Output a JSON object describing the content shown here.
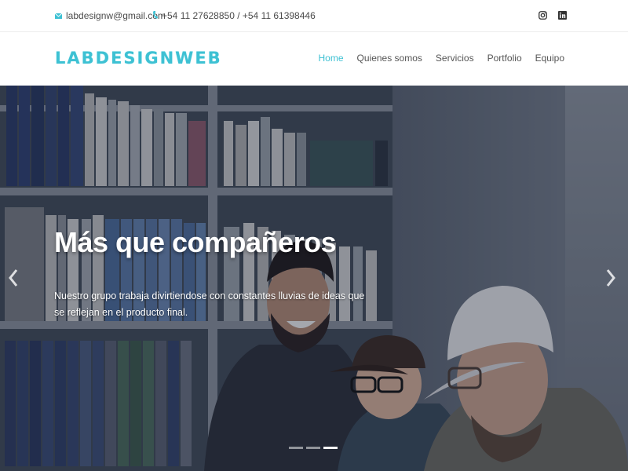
{
  "topbar": {
    "email": "labdesignw@gmail.com",
    "phone": "+54 11 27628850 / +54 11 61398446",
    "email_icon": "envelope-icon",
    "phone_icon": "phone-icon",
    "social": [
      "instagram-icon",
      "linkedin-icon"
    ]
  },
  "header": {
    "logo": "LABDESIGNWEB",
    "nav": [
      "Home",
      "Quienes somos",
      "Servicios",
      "Portfolio",
      "Equipo"
    ],
    "active_nav": "Home"
  },
  "hero": {
    "title": "Más que compañeros",
    "text": "Nuestro grupo trabaja divirtiendose con constantes lluvias de ideas que se reflejan en el producto final.",
    "slides_count": 3,
    "active_slide": 3,
    "prev_icon": "chevron-left-icon",
    "next_icon": "chevron-right-icon"
  },
  "colors": {
    "accent": "#3ec1d3",
    "text": "#555555"
  }
}
